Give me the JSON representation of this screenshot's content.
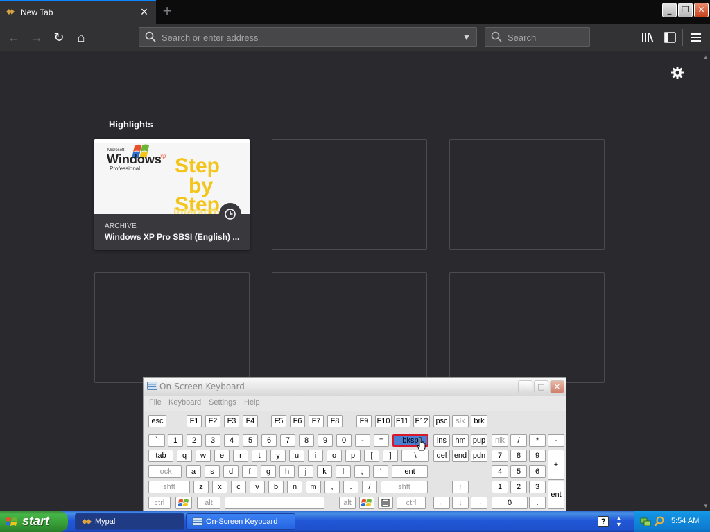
{
  "browser": {
    "tab": {
      "title": "New Tab",
      "close_glyph": "×"
    },
    "new_tab_glyph": "+",
    "nav": {
      "back_glyph": "←",
      "forward_glyph": "→",
      "reload_glyph": "↻",
      "home_glyph": "⌂"
    },
    "address": {
      "placeholder": "Search or enter address",
      "value": ""
    },
    "search": {
      "placeholder": "Search",
      "value": ""
    },
    "window_controls": {
      "minimize": "_",
      "restore": "❐",
      "close": "✕"
    }
  },
  "newtab": {
    "highlights_title": "Highlights",
    "cards": [
      {
        "context": "ARCHIVE",
        "title": "Windows XP Pro SBSI (English) ...",
        "thumb": {
          "brand_small": "Microsoft",
          "brand": "Windows",
          "brand_sup": "xp",
          "edition": "Professional",
          "big_text": [
            "Step",
            "by",
            "Step"
          ],
          "faint_text": "Interactive"
        }
      },
      {},
      {},
      {},
      {},
      {}
    ]
  },
  "osk": {
    "title": "On-Screen Keyboard",
    "menu": [
      "File",
      "Keyboard",
      "Settings",
      "Help"
    ],
    "title_buttons": {
      "min": "_",
      "max": "□",
      "close": "✕"
    },
    "rows": [
      [
        "esc",
        "F1",
        "F2",
        "F3",
        "F4",
        "F5",
        "F6",
        "F7",
        "F8",
        "F9",
        "F10",
        "F11",
        "F12",
        "psc",
        "slk",
        "brk"
      ],
      [
        "`",
        "1",
        "2",
        "3",
        "4",
        "5",
        "6",
        "7",
        "8",
        "9",
        "0",
        "-",
        "=",
        "bksp",
        "ins",
        "hm",
        "pup",
        "nlk",
        "/",
        "*",
        "-"
      ],
      [
        "tab",
        "q",
        "w",
        "e",
        "r",
        "t",
        "y",
        "u",
        "i",
        "o",
        "p",
        "[",
        "]",
        "\\",
        "del",
        "end",
        "pdn",
        "7",
        "8",
        "9",
        "+"
      ],
      [
        "lock",
        "a",
        "s",
        "d",
        "f",
        "g",
        "h",
        "j",
        "k",
        "l",
        ";",
        "'",
        "ent",
        "4",
        "5",
        "6"
      ],
      [
        "shft",
        "z",
        "x",
        "c",
        "v",
        "b",
        "n",
        "m",
        ",",
        ".",
        "/",
        "shft",
        "↑",
        "1",
        "2",
        "3",
        "ent"
      ],
      [
        "ctrl",
        "win",
        "alt",
        "space",
        "alt",
        "win",
        "menu",
        "ctrl",
        "←",
        "↓",
        "→",
        "0",
        "."
      ]
    ],
    "active_key": "bksp"
  },
  "taskbar": {
    "start_label": "start",
    "tasks": [
      {
        "label": "Mypal",
        "state": "inactive"
      },
      {
        "label": "On-Screen Keyboard",
        "state": "normal"
      }
    ],
    "help_glyph": "?",
    "clock": "5:54 AM"
  }
}
